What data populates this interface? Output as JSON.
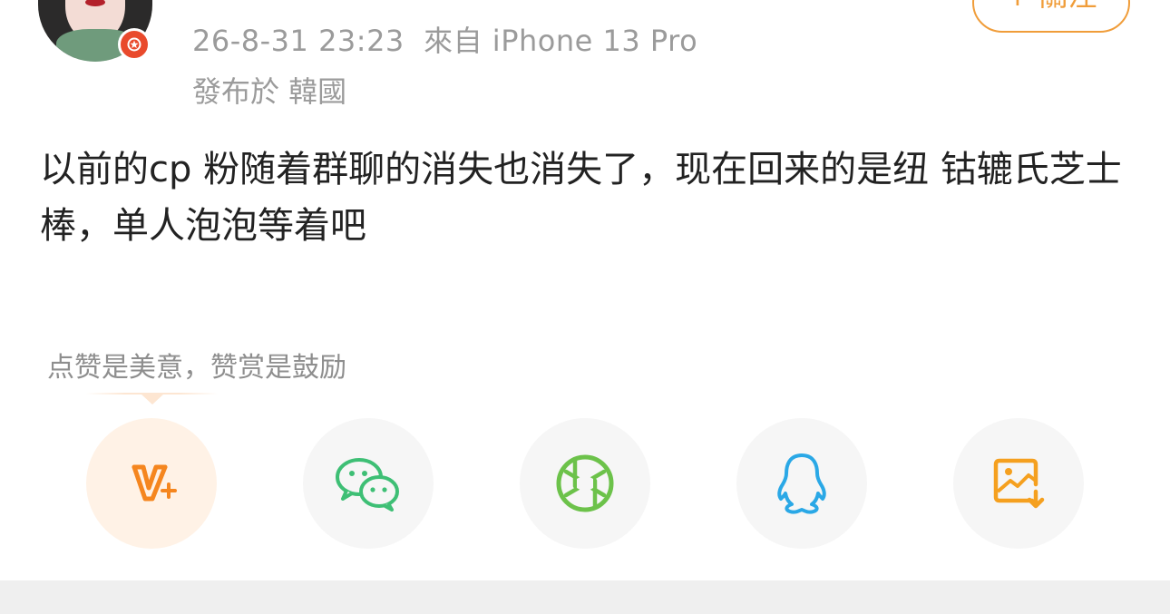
{
  "post": {
    "timestamp": "26-8-31 23:23",
    "source": "來自 iPhone 13 Pro",
    "location": "發布於 韓國",
    "text": "以前的cp 粉随着群聊的消失也消失了，现在回来的是纽 钴辘氏芝士棒，单人泡泡等着吧"
  },
  "header": {
    "follow_label": "+ 關注"
  },
  "reward": {
    "hint": "点赞是美意，赞赏是鼓励"
  },
  "share_targets": [
    {
      "icon": "v-plus-icon",
      "color": "#f5861f"
    },
    {
      "icon": "wechat-icon",
      "color": "#3ebf75"
    },
    {
      "icon": "moments-icon",
      "color": "#6cc24a"
    },
    {
      "icon": "qq-icon",
      "color": "#2aa8e6"
    },
    {
      "icon": "save-image-icon",
      "color": "#f5a01f"
    }
  ],
  "colors": {
    "accent": "#f09d3a",
    "meta_text": "#9b9b9b",
    "body_text": "#222222"
  }
}
